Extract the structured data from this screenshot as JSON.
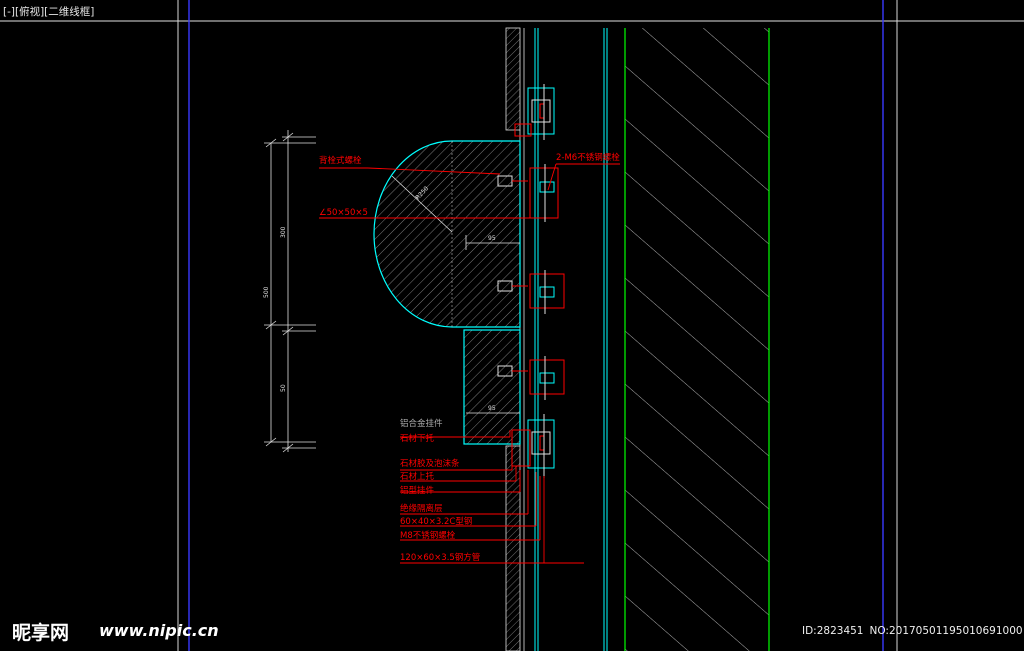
{
  "viewport": {
    "label": "[-][俯视][二维线框]"
  },
  "dimensions": {
    "total": "500",
    "upper": "300",
    "lower": "50",
    "radius": "R250",
    "offset_a": "95",
    "offset_b": "95"
  },
  "annotations": [
    "背栓式螺栓",
    "∠50×50×5",
    "2-M6不锈钢螺栓",
    "铝合金挂件",
    "石材下托",
    "石材胶及泡沫条",
    "石材上托",
    "铝型挂件",
    "绝缘隔离层",
    "60×40×3.2C型钢",
    "M8不锈钢螺栓",
    "120×60×3.5钢方管"
  ],
  "watermark": {
    "logo": "昵享网",
    "url": "www.nipic.cn",
    "id": "ID:2823451",
    "no": "NO:20170501195010691000"
  },
  "colors": {
    "background": "#000000",
    "cyan": "#00ffff",
    "red": "#ff0000",
    "green": "#00ff00",
    "blue": "#3a3aff",
    "white": "#ffffff"
  }
}
